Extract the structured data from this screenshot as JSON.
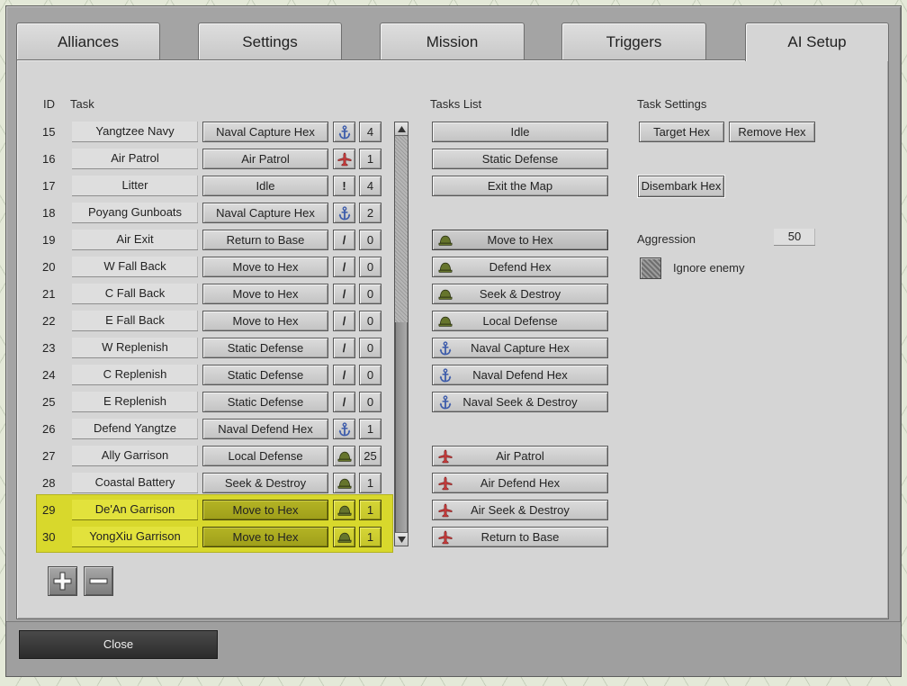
{
  "window": {
    "tabs": [
      {
        "label": "Alliances",
        "active": false
      },
      {
        "label": "Settings",
        "active": false
      },
      {
        "label": "Mission",
        "active": false
      },
      {
        "label": "Triggers",
        "active": false
      },
      {
        "label": "AI Setup",
        "active": true
      }
    ]
  },
  "colors": {
    "selection_highlight": "#d8d82c",
    "anchor_icon": "#3d5cab",
    "plane_icon": "#c33a3a",
    "helmet_icon": "#66752c"
  },
  "task_table": {
    "headers": {
      "id": "ID",
      "task": "Task"
    },
    "rows": [
      {
        "id": "15",
        "name": "Yangtzee Navy",
        "task": "Naval Capture Hex",
        "icon": "anchor-icon",
        "count": "4"
      },
      {
        "id": "16",
        "name": "Air Patrol",
        "task": "Air Patrol",
        "icon": "plane-icon",
        "count": "1"
      },
      {
        "id": "17",
        "name": "Litter",
        "task": "Idle",
        "mark": "!",
        "count": "4"
      },
      {
        "id": "18",
        "name": "Poyang Gunboats",
        "task": "Naval Capture Hex",
        "icon": "anchor-icon",
        "count": "2"
      },
      {
        "id": "19",
        "name": "Air Exit",
        "task": "Return to Base",
        "mark": "/",
        "count": "0"
      },
      {
        "id": "20",
        "name": "W Fall Back",
        "task": "Move to Hex",
        "mark": "/",
        "count": "0"
      },
      {
        "id": "21",
        "name": "C Fall Back",
        "task": "Move to Hex",
        "mark": "/",
        "count": "0"
      },
      {
        "id": "22",
        "name": "E Fall Back",
        "task": "Move to Hex",
        "mark": "/",
        "count": "0"
      },
      {
        "id": "23",
        "name": "W Replenish",
        "task": "Static Defense",
        "mark": "/",
        "count": "0"
      },
      {
        "id": "24",
        "name": "C Replenish",
        "task": "Static Defense",
        "mark": "/",
        "count": "0"
      },
      {
        "id": "25",
        "name": "E Replenish",
        "task": "Static Defense",
        "mark": "/",
        "count": "0"
      },
      {
        "id": "26",
        "name": "Defend Yangtze",
        "task": "Naval Defend Hex",
        "icon": "anchor-icon",
        "count": "1"
      },
      {
        "id": "27",
        "name": "Ally Garrison",
        "task": "Local Defense",
        "icon": "helmet-icon",
        "count": "25"
      },
      {
        "id": "28",
        "name": "Coastal Battery",
        "task": "Seek & Destroy",
        "icon": "helmet-icon",
        "count": "1"
      },
      {
        "id": "29",
        "name": "De'An Garrison",
        "task": "Move to Hex",
        "icon": "helmet-icon",
        "count": "1",
        "selected": true
      },
      {
        "id": "30",
        "name": "YongXiu Garrison",
        "task": "Move to Hex",
        "icon": "helmet-icon",
        "count": "1",
        "selected": true
      }
    ],
    "scroll": {
      "visible_fraction": 0.53,
      "position": 1.0
    },
    "controls": {
      "add_icon": "plus-icon",
      "remove_icon": "minus-icon"
    }
  },
  "tasks_list": {
    "title": "Tasks List",
    "groups": [
      {
        "items": [
          {
            "label": "Idle"
          },
          {
            "label": "Static Defense"
          },
          {
            "label": "Exit the Map"
          }
        ]
      },
      {
        "items": [
          {
            "label": "Move to Hex",
            "icon": "helmet-icon",
            "current": true
          },
          {
            "label": "Defend Hex",
            "icon": "helmet-icon"
          },
          {
            "label": "Seek & Destroy",
            "icon": "helmet-icon"
          },
          {
            "label": "Local Defense",
            "icon": "helmet-icon"
          },
          {
            "label": "Naval Capture Hex",
            "icon": "anchor-icon"
          },
          {
            "label": "Naval Defend Hex",
            "icon": "anchor-icon"
          },
          {
            "label": "Naval Seek & Destroy",
            "icon": "anchor-icon"
          }
        ]
      },
      {
        "items": [
          {
            "label": "Air Patrol",
            "icon": "plane-icon"
          },
          {
            "label": "Air Defend Hex",
            "icon": "plane-icon"
          },
          {
            "label": "Air Seek & Destroy",
            "icon": "plane-icon"
          },
          {
            "label": "Return to Base",
            "icon": "plane-icon"
          }
        ]
      }
    ]
  },
  "task_settings": {
    "title": "Task Settings",
    "target_hex": "Target Hex",
    "remove_hex": "Remove Hex",
    "disembark_hex": "Disembark Hex",
    "aggression": {
      "label": "Aggression",
      "value": "50"
    },
    "ignore_enemy": {
      "label": "Ignore enemy",
      "checked": false
    }
  },
  "footer": {
    "close": "Close"
  }
}
